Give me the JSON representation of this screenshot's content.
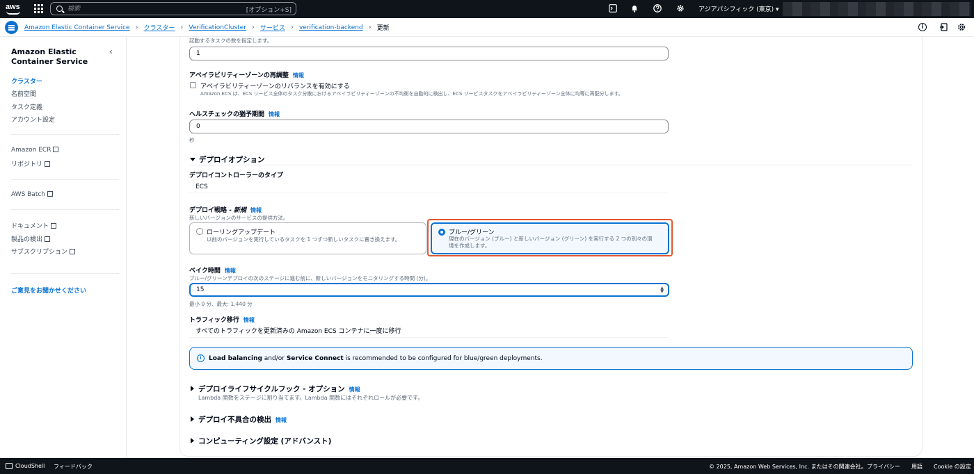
{
  "topnav": {
    "logo_text": "aws",
    "search_placeholder": "検索",
    "search_shortcut": "[オプション+S]",
    "region": "アジアパシフィック (東京) ▾"
  },
  "breadcrumb": {
    "items": [
      "Amazon Elastic Container Service",
      "クラスター",
      "VerificationCluster",
      "サービス",
      "verification-backend"
    ],
    "current": "更新"
  },
  "sidebar": {
    "title": "Amazon Elastic Container Service",
    "nav": [
      "クラスター",
      "名前空間",
      "タスク定義",
      "アカウント設定"
    ],
    "links1": [
      "Amazon ECR",
      "リポジトリ"
    ],
    "links2": [
      "AWS Batch"
    ],
    "links3": [
      "ドキュメント",
      "製品の検出",
      "サブスクリプション"
    ],
    "feedback": "ご意見をお聞かせください"
  },
  "form": {
    "task_count_desc": "起動するタスクの数を指定します。",
    "task_count_value": "1",
    "az_rebalance_label": "アベイラビリティーゾーンの再調整",
    "info": "情報",
    "az_rebalance_checkbox": "アベイラビリティーゾーンのリバランスを有効にする",
    "az_rebalance_desc": "Amazon ECS は、ECS リービス全体のタスク分散におけるアベイラビリティーゾーンの不均衡を自動的に検出し、ECS リービスタスクをアベイラビリティーゾーン全体に均等に再配分します。",
    "health_grace_label": "ヘルスチェックの猶予期間",
    "health_grace_value": "0",
    "health_grace_unit": "秒",
    "deploy_options_heading": "デプロイオプション",
    "controller_type_label": "デプロイコントローラーのタイプ",
    "controller_type_value": "ECS",
    "strategy_label": "デプロイ戦略 - ",
    "strategy_label_new": "新規",
    "strategy_desc": "新しいバージョンのサービスの提供方法。",
    "rolling_title": "ローリングアップデート",
    "rolling_desc": "以前のバージョンを実行しているタスクを 1 つずつ新しいタスクに置き換えます。",
    "bluegreen_title": "ブルー/グリーン",
    "bluegreen_desc1": "現在のバージョン (ブルー) と新しいバージョン (グリーン) を実行する 2 つの別々の環",
    "bluegreen_desc2": "境を作成します。",
    "bake_label": "ベイク時間",
    "bake_desc": "ブルー/グリーンデプロイの次のステージに進む前に、新しいバージョンをモニタリングする時間 (分)。",
    "bake_value": "15",
    "bake_range": "最小 0 分、最大: 1,440 分",
    "traffic_label": "トラフィック移行",
    "traffic_value": "すべてのトラフィックを更新済みの Amazon ECS コンテナに一度に移行",
    "alert_b1": "Load balancing",
    "alert_t1": " and/or ",
    "alert_b2": "Service Connect",
    "alert_t2": " is recommended to be configured for blue/green deployments.",
    "lifecycle_heading": "デプロイライフサイクルフック - オプション",
    "lifecycle_desc": "Lambda 関数をステージに割り当てます。Lambda 関数にはそれぞれロールが必要です。",
    "failure_heading": "デプロイ不具合の検出",
    "compute_heading": "コンピューティング設定 (アドバンスト)"
  },
  "footer": {
    "cloudshell": "CloudShell",
    "feedback": "フィードバック",
    "copyright": "© 2025, Amazon Web Services, Inc. またはその関連会社。",
    "privacy": "プライバシー",
    "terms": "用語",
    "cookie": "Cookie の設定"
  }
}
